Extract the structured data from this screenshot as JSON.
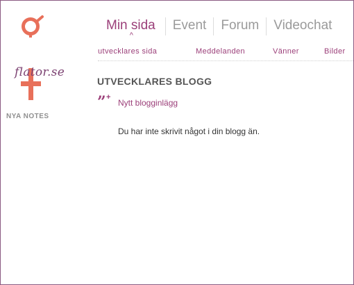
{
  "logo": {
    "text": "flator.se"
  },
  "nav": {
    "main": [
      {
        "label": "Min sida",
        "active": true
      },
      {
        "label": "Event"
      },
      {
        "label": "Forum"
      },
      {
        "label": "Videochat"
      }
    ],
    "sub": [
      "utvecklares sida",
      "Meddelanden",
      "Vänner",
      "Bilder"
    ]
  },
  "sidebar": {
    "heading": "NYA NOTES"
  },
  "main": {
    "title": "UTVECKLARES BLOGG",
    "new_post_label": "Nytt blogginlägg",
    "empty_message": "Du har inte skrivit något i din blogg än."
  },
  "colors": {
    "accent": "#9b3f79",
    "logo_symbol": "#e8705a",
    "logo_text": "#7d4373",
    "frame": "#8a5a82"
  },
  "icons": {
    "logo": "venus-symbol-icon",
    "new_post": "quote-plus-icon"
  }
}
